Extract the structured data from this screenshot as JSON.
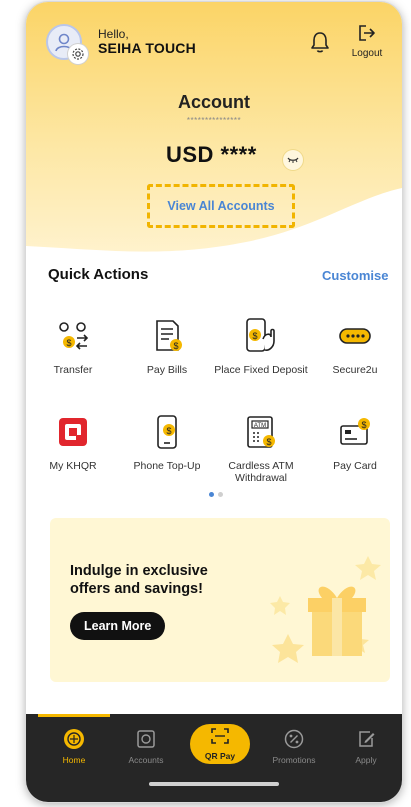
{
  "header": {
    "greeting": "Hello,",
    "user_name": "SEIHA TOUCH",
    "logout_label": "Logout"
  },
  "account": {
    "title": "Account",
    "account_number_masked": "***************",
    "balance": "USD ****",
    "view_all_label": "View All Accounts"
  },
  "quick_actions": {
    "title": "Quick Actions",
    "customise_label": "Customise",
    "items": [
      {
        "label": "Transfer",
        "icon": "transfer-icon"
      },
      {
        "label": "Pay Bills",
        "icon": "bill-icon"
      },
      {
        "label": "Place Fixed Deposit",
        "icon": "fixed-deposit-icon"
      },
      {
        "label": "Secure2u",
        "icon": "secure2u-icon"
      },
      {
        "label": "My KHQR",
        "icon": "khqr-icon"
      },
      {
        "label": "Phone Top-Up",
        "icon": "phone-topup-icon"
      },
      {
        "label": "Cardless ATM Withdrawal",
        "icon": "atm-icon"
      },
      {
        "label": "Pay Card",
        "icon": "pay-card-icon"
      }
    ],
    "page_indicator": {
      "pages": 2,
      "current": 1
    }
  },
  "promo": {
    "text": "Indulge in exclusive offers and savings!",
    "button_label": "Learn More"
  },
  "bottom_nav": {
    "items": [
      {
        "label": "Home",
        "icon": "home-icon",
        "active": true
      },
      {
        "label": "Accounts",
        "icon": "accounts-icon",
        "active": false
      },
      {
        "label": "QR Pay",
        "icon": "qr-scan-icon",
        "active": false
      },
      {
        "label": "Promotions",
        "icon": "promotions-icon",
        "active": false
      },
      {
        "label": "Apply",
        "icon": "apply-icon",
        "active": false
      }
    ]
  },
  "colors": {
    "brand_yellow": "#f5b800",
    "link_blue": "#4a86d4",
    "nav_background": "#262626",
    "promo_background": "#fff7d4"
  }
}
